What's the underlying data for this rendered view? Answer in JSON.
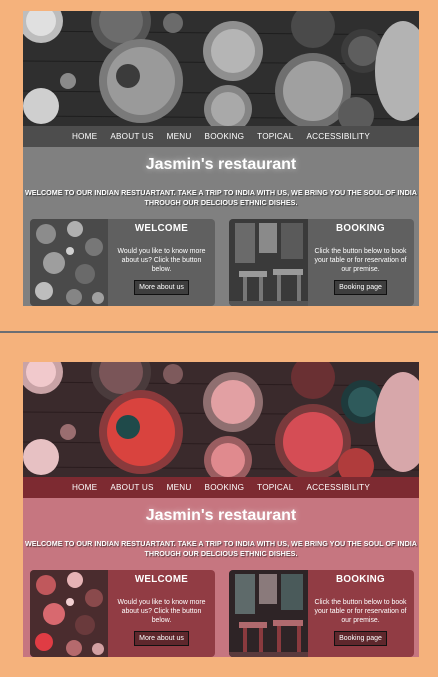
{
  "site": {
    "nav": [
      "HOME",
      "ABOUT US",
      "MENU",
      "BOOKING",
      "TOPICAL",
      "ACCESSIBILITY"
    ],
    "title": "Jasmin's restaurant",
    "intro": "WELCOME TO OUR INDIAN RESTUARTANT. TAKE A TRIP TO INDIA WITH US, WE BRING YOU THE SOUL OF INDIA THROUGH OUR DELCIOUS ETHNIC DISHES.",
    "cards": [
      {
        "title": "WELCOME",
        "text": "Would you like to know more about us? Click the button below.",
        "button": "More about us",
        "image_icon": "spices-photo"
      },
      {
        "title": "BOOKING",
        "text": "Click the button below to book your table or for reservation of our premise.",
        "button": "Booking page",
        "image_icon": "restaurant-interior-photo"
      }
    ]
  },
  "themes": {
    "grayscale": {
      "nav_bg": "#4d4d4d",
      "body_bg": "#808080",
      "card_bg": "#606060"
    },
    "tinted": {
      "nav_bg": "#7d2a31",
      "body_bg": "#c67680",
      "card_bg": "#913c44"
    }
  }
}
